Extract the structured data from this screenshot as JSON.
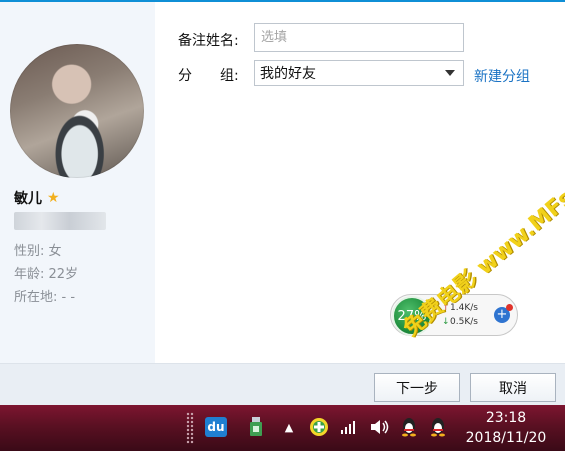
{
  "profile": {
    "name": "敏儿",
    "gender": "性别: 女",
    "age": "年龄: 22岁",
    "location": "所在地: -    -"
  },
  "form": {
    "remark_label": "备注姓名:",
    "remark_placeholder": "选填",
    "group_label": "分　　组:",
    "group_value": "我的好友",
    "new_group_link": "新建分组"
  },
  "buttons": {
    "next": "下一步",
    "cancel": "取消"
  },
  "net_widget": {
    "percent": "27%",
    "upload": "1.4K/s",
    "download": "0.5K/s"
  },
  "taskbar": {
    "time": "23:18",
    "date": "2018/11/20",
    "du_icon": "du"
  },
  "watermark": "免费电影 www.MFsese.com",
  "colors": {
    "accent": "#0f8fd6",
    "link": "#1b73c4",
    "taskbar": "#5a1022",
    "star": "#f2b01e"
  }
}
